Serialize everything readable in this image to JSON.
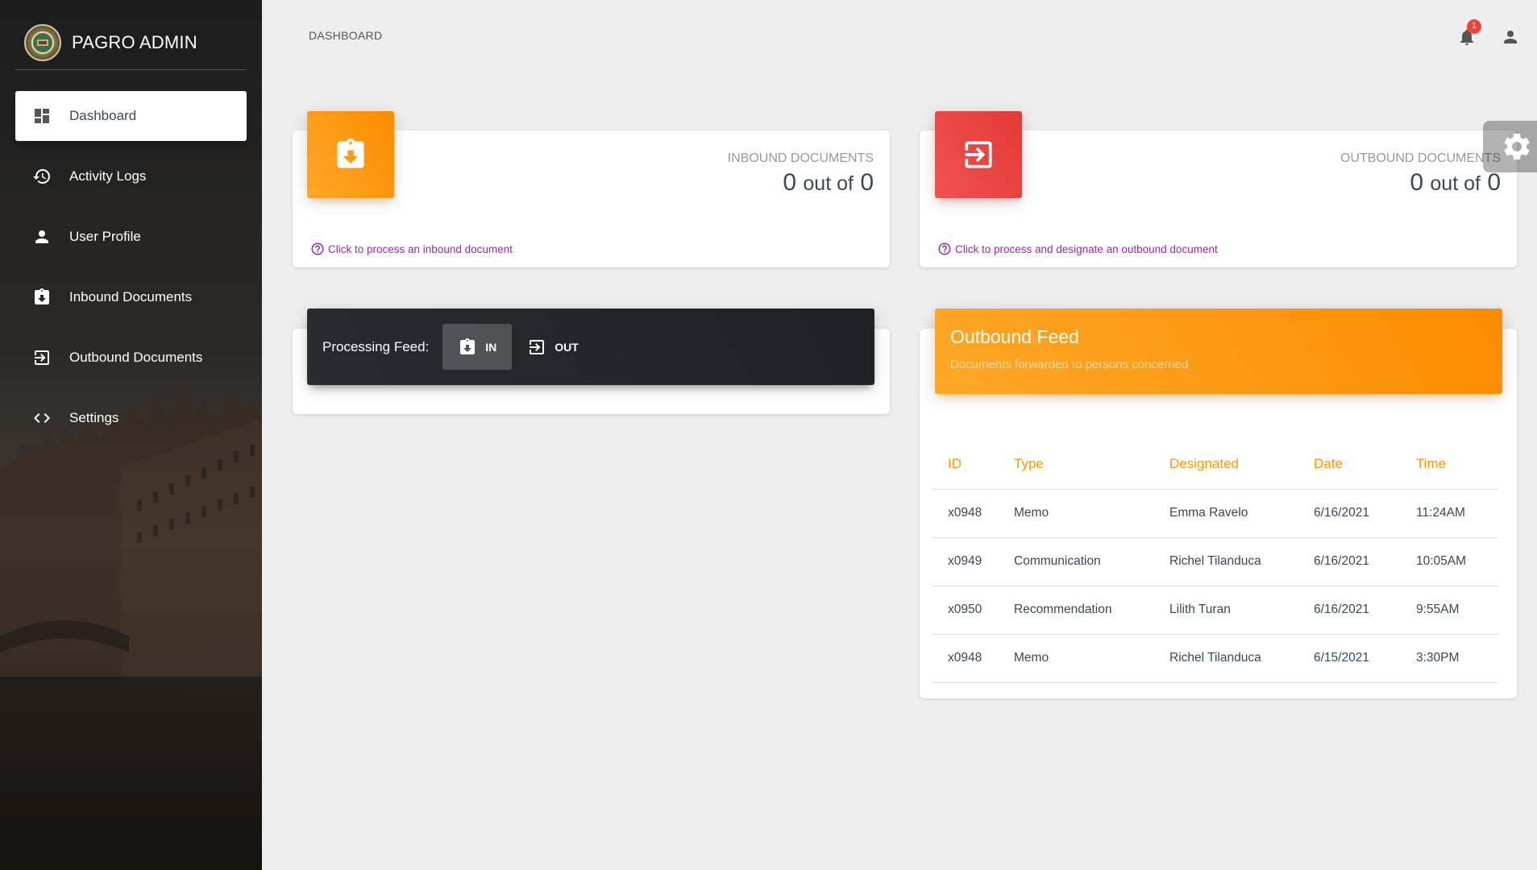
{
  "sidebar": {
    "brand": "PAGRO ADMIN",
    "items": [
      {
        "label": "Dashboard",
        "icon": "dashboard-icon"
      },
      {
        "label": "Activity Logs",
        "icon": "history-icon"
      },
      {
        "label": "User Profile",
        "icon": "person-icon"
      },
      {
        "label": "Inbound Documents",
        "icon": "clipboard-download-icon"
      },
      {
        "label": "Outbound Documents",
        "icon": "exit-arrow-icon"
      },
      {
        "label": "Settings",
        "icon": "code-brackets-icon"
      }
    ]
  },
  "header": {
    "title": "DASHBOARD",
    "notification_count": "1"
  },
  "stats": {
    "inbound": {
      "category": "INBOUND DOCUMENTS",
      "count": "0",
      "connector": "out of",
      "total": "0",
      "footer": "Click to process an inbound document"
    },
    "outbound": {
      "category": "OUTBOUND DOCUMENTS",
      "count": "0",
      "connector": "out of",
      "total": "0",
      "footer": "Click to process and designate an outbound document"
    }
  },
  "processing_feed": {
    "label": "Processing Feed:",
    "tabs": [
      "IN",
      "OUT"
    ],
    "active_tab": "IN"
  },
  "outbound_feed": {
    "title": "Outbound Feed",
    "subtitle": "Documents forwarded to persons concerned",
    "columns": [
      "ID",
      "Type",
      "Designated",
      "Date",
      "Time"
    ],
    "rows": [
      [
        "x0948",
        "Memo",
        "Emma Ravelo",
        "6/16/2021",
        "11:24AM"
      ],
      [
        "x0949",
        "Communication",
        "Richel Tilanduca",
        "6/16/2021",
        "10:05AM"
      ],
      [
        "x0950",
        "Recommendation",
        "Lilith Turan",
        "6/16/2021",
        "9:55AM"
      ],
      [
        "x0948",
        "Memo",
        "Richel Tilanduca",
        "6/15/2021",
        "3:30PM"
      ]
    ]
  },
  "colors": {
    "accent_orange": "#fb8c00",
    "accent_red": "#e53935",
    "link_purple": "#9c27b0",
    "badge_red": "#f44336"
  }
}
